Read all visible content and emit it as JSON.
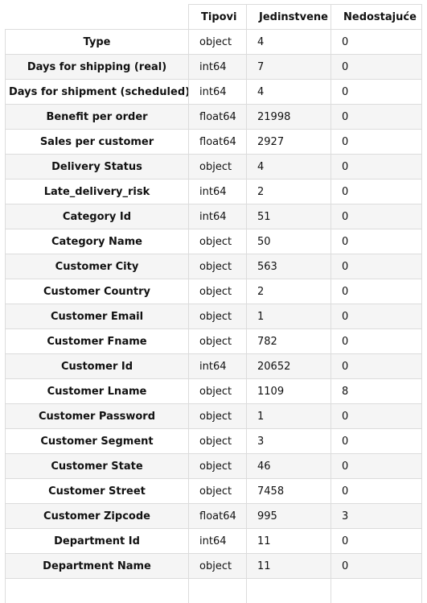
{
  "table": {
    "headers": [
      "",
      "Tipovi",
      "Jedinstvene",
      "Nedostajuće"
    ],
    "rows": [
      {
        "name": "Type",
        "dtype": "object",
        "unique": "4",
        "missing": "0"
      },
      {
        "name": "Days for shipping (real)",
        "dtype": "int64",
        "unique": "7",
        "missing": "0"
      },
      {
        "name": "Days for shipment (scheduled)",
        "dtype": "int64",
        "unique": "4",
        "missing": "0"
      },
      {
        "name": "Benefit per order",
        "dtype": "float64",
        "unique": "21998",
        "missing": "0"
      },
      {
        "name": "Sales per customer",
        "dtype": "float64",
        "unique": "2927",
        "missing": "0"
      },
      {
        "name": "Delivery Status",
        "dtype": "object",
        "unique": "4",
        "missing": "0"
      },
      {
        "name": "Late_delivery_risk",
        "dtype": "int64",
        "unique": "2",
        "missing": "0"
      },
      {
        "name": "Category Id",
        "dtype": "int64",
        "unique": "51",
        "missing": "0"
      },
      {
        "name": "Category Name",
        "dtype": "object",
        "unique": "50",
        "missing": "0"
      },
      {
        "name": "Customer City",
        "dtype": "object",
        "unique": "563",
        "missing": "0"
      },
      {
        "name": "Customer Country",
        "dtype": "object",
        "unique": "2",
        "missing": "0"
      },
      {
        "name": "Customer Email",
        "dtype": "object",
        "unique": "1",
        "missing": "0"
      },
      {
        "name": "Customer Fname",
        "dtype": "object",
        "unique": "782",
        "missing": "0"
      },
      {
        "name": "Customer Id",
        "dtype": "int64",
        "unique": "20652",
        "missing": "0"
      },
      {
        "name": "Customer Lname",
        "dtype": "object",
        "unique": "1109",
        "missing": "8"
      },
      {
        "name": "Customer Password",
        "dtype": "object",
        "unique": "1",
        "missing": "0"
      },
      {
        "name": "Customer Segment",
        "dtype": "object",
        "unique": "3",
        "missing": "0"
      },
      {
        "name": "Customer State",
        "dtype": "object",
        "unique": "46",
        "missing": "0"
      },
      {
        "name": "Customer Street",
        "dtype": "object",
        "unique": "7458",
        "missing": "0"
      },
      {
        "name": "Customer Zipcode",
        "dtype": "float64",
        "unique": "995",
        "missing": "3"
      },
      {
        "name": "Department Id",
        "dtype": "int64",
        "unique": "11",
        "missing": "0"
      },
      {
        "name": "Department Name",
        "dtype": "object",
        "unique": "11",
        "missing": "0"
      },
      {
        "name": "",
        "dtype": "",
        "unique": "",
        "missing": ""
      }
    ]
  }
}
